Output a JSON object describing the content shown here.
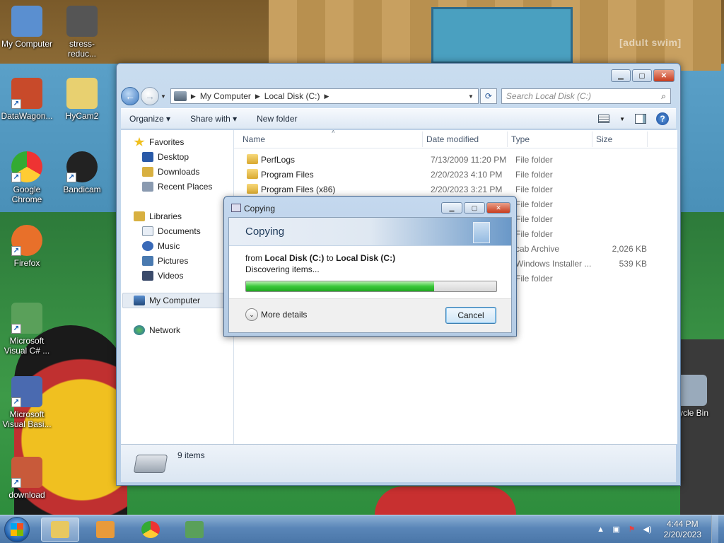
{
  "watermark": "[adult swim]",
  "desktop_icons": [
    {
      "name": "desktop-icon-my-computer",
      "label": "My Computer",
      "icon": "computer-icon",
      "color": "#5a8fd0"
    },
    {
      "name": "desktop-icon-stress-reducer",
      "label": "stress-reduc...",
      "icon": "camera-icon",
      "color": "#555"
    },
    {
      "name": "desktop-icon-datawagon",
      "label": "DataWagon...",
      "icon": "star-icon",
      "color": "#c84a2a"
    },
    {
      "name": "desktop-icon-hycam2",
      "label": "HyCam2",
      "icon": "folder-icon",
      "color": "#e8d070"
    },
    {
      "name": "desktop-icon-chrome",
      "label": "Google Chrome",
      "icon": "chrome-icon",
      "color": "#3a7ae0"
    },
    {
      "name": "desktop-icon-bandicam",
      "label": "Bandicam",
      "icon": "bandicam-icon",
      "color": "#222"
    },
    {
      "name": "desktop-icon-firefox",
      "label": "Firefox",
      "icon": "firefox-icon",
      "color": "#e8702a"
    },
    {
      "name": "desktop-icon-visual-csharp",
      "label": "Microsoft Visual C# ...",
      "icon": "csharp-icon",
      "color": "#5aa05a"
    },
    {
      "name": "desktop-icon-visual-basic",
      "label": "Microsoft Visual Basi...",
      "icon": "vb-icon",
      "color": "#4a6ab0"
    },
    {
      "name": "desktop-icon-download",
      "label": "download",
      "icon": "image-icon",
      "color": "#c85a3a"
    },
    {
      "name": "desktop-icon-recycle-bin",
      "label": "cycle Bin",
      "icon": "recycle-bin-icon",
      "color": "#9ab"
    }
  ],
  "explorer": {
    "breadcrumb": [
      "My Computer",
      "Local Disk (C:)"
    ],
    "search_placeholder": "Search Local Disk (C:)",
    "toolbar": {
      "organize": "Organize",
      "share_with": "Share with",
      "new_folder": "New folder"
    },
    "nav": {
      "favorites": "Favorites",
      "favorites_items": [
        "Desktop",
        "Downloads",
        "Recent Places"
      ],
      "libraries": "Libraries",
      "libraries_items": [
        "Documents",
        "Music",
        "Pictures",
        "Videos"
      ],
      "my_computer": "My Computer",
      "network": "Network"
    },
    "columns": {
      "name": "Name",
      "date": "Date modified",
      "type": "Type",
      "size": "Size"
    },
    "rows": [
      {
        "name": "PerfLogs",
        "date": "7/13/2009 11:20 PM",
        "type": "File folder",
        "size": ""
      },
      {
        "name": "Program Files",
        "date": "2/20/2023 4:10 PM",
        "type": "File folder",
        "size": ""
      },
      {
        "name": "Program Files (x86)",
        "date": "2/20/2023 3:21 PM",
        "type": "File folder",
        "size": ""
      },
      {
        "name": "",
        "date": "",
        "type": "File folder",
        "size": ""
      },
      {
        "name": "",
        "date": "",
        "type": "File folder",
        "size": ""
      },
      {
        "name": "",
        "date": "",
        "type": "File folder",
        "size": ""
      },
      {
        "name": "",
        "date": "",
        "type": "cab Archive",
        "size": "2,026 KB"
      },
      {
        "name": "",
        "date": "",
        "type": "Windows Installer ...",
        "size": "539 KB"
      },
      {
        "name": "",
        "date": "",
        "type": "File folder",
        "size": ""
      }
    ],
    "status_count": "9 items"
  },
  "copy_dialog": {
    "title": "Copying",
    "heading": "Copying",
    "from_prefix": "from",
    "from_source": "Local Disk (C:)",
    "to_word": "to",
    "to_dest": "Local Disk (C:)",
    "status": "Discovering items...",
    "progress": 0.75,
    "more_details": "More details",
    "cancel": "Cancel"
  },
  "taskbar": {
    "apps": [
      {
        "name": "taskbar-explorer",
        "icon": "folder-icon",
        "color": "#e8c860",
        "active": true
      },
      {
        "name": "taskbar-media-player",
        "icon": "media-player-icon",
        "color": "#e89a3a",
        "active": false
      },
      {
        "name": "taskbar-chrome",
        "icon": "chrome-icon",
        "color": "#3a7ae0",
        "active": false
      },
      {
        "name": "taskbar-visual-csharp",
        "icon": "csharp-icon",
        "color": "#5aa05a",
        "active": false
      }
    ],
    "time": "4:44 PM",
    "date": "2/20/2023"
  }
}
